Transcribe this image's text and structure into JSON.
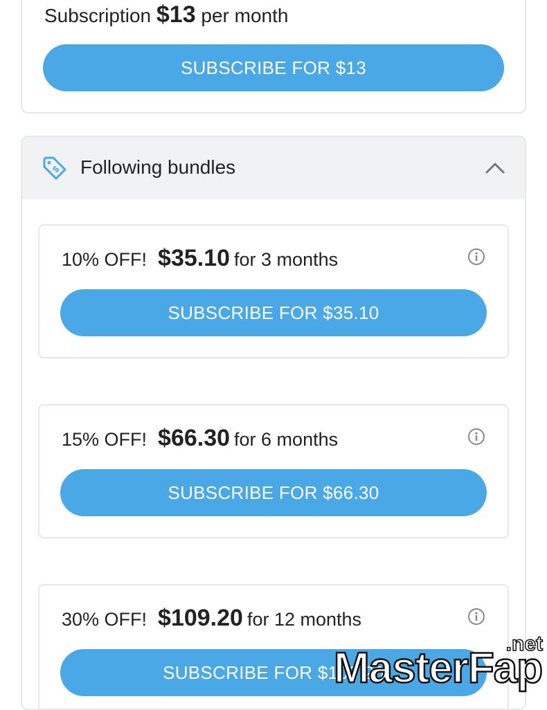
{
  "subscription": {
    "label_prefix": "Subscription",
    "price": "$13",
    "label_suffix": "per month",
    "button_label": "SUBSCRIBE FOR $13"
  },
  "bundles_section": {
    "title": "Following bundles",
    "icon": "price-tag-icon",
    "collapse_icon": "chevron-up-icon",
    "items": [
      {
        "discount": "10% OFF!",
        "price": "$35.10",
        "period": "for 3 months",
        "button_label": "SUBSCRIBE FOR $35.10"
      },
      {
        "discount": "15% OFF!",
        "price": "$66.30",
        "period": "for 6 months",
        "button_label": "SUBSCRIBE FOR $66.30"
      },
      {
        "discount": "30% OFF!",
        "price": "$109.20",
        "period": "for 12 months",
        "button_label": "SUBSCRIBE FOR $109.20"
      }
    ]
  },
  "watermark": {
    "text": "MasterFap",
    "suffix": ".net"
  },
  "colors": {
    "accent": "#4aa8e6",
    "header_bg": "#f0f2f4",
    "border": "#e6e8ea",
    "icon": "#4aa8e6"
  }
}
